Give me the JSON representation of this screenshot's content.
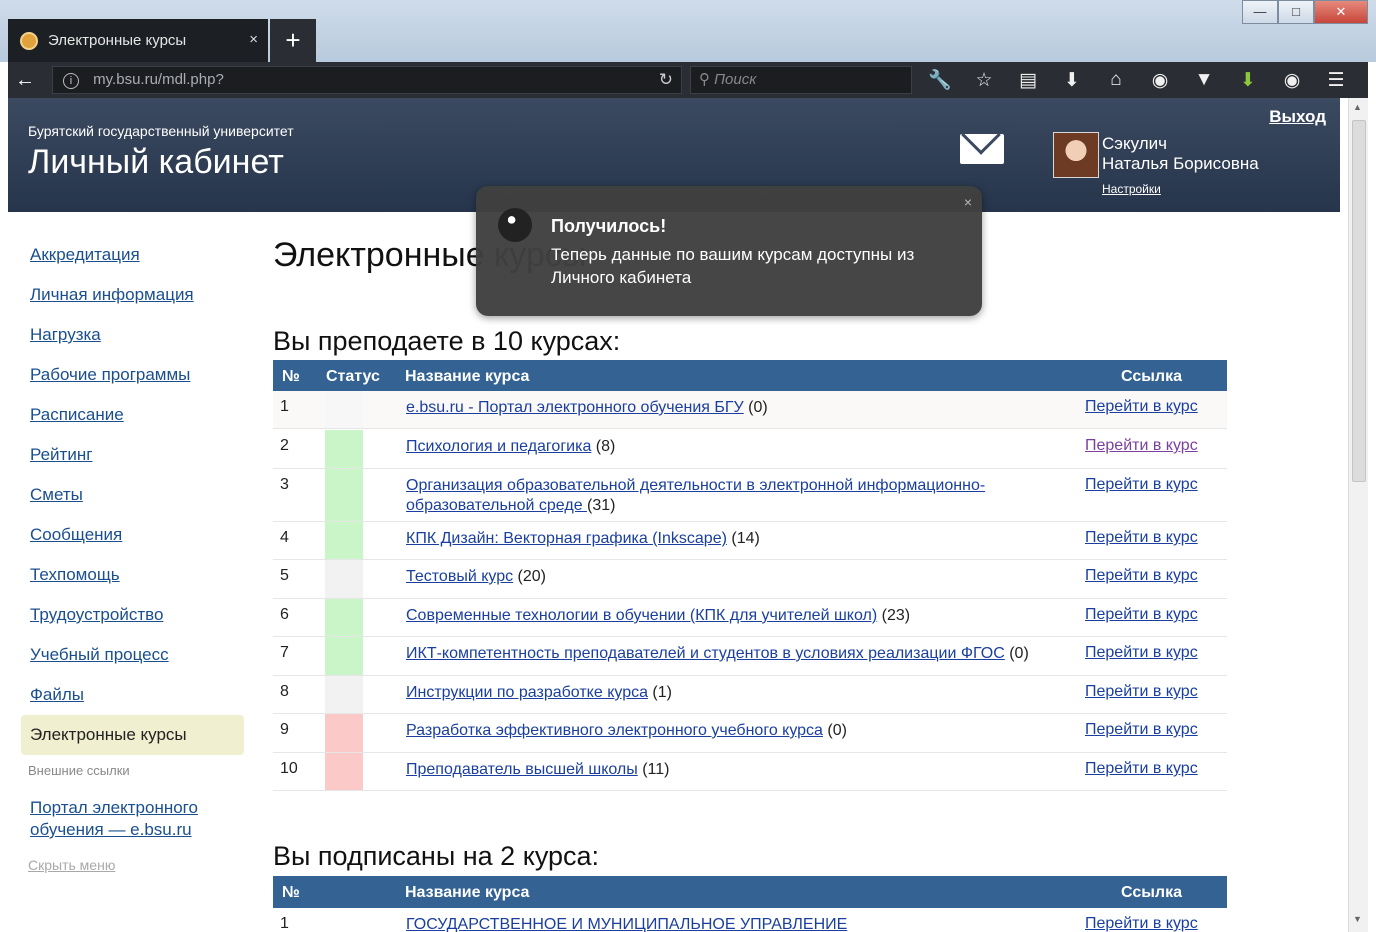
{
  "browser": {
    "tab_title": "Электронные курсы",
    "tab_close": "×",
    "new_tab": "+",
    "url": "my.bsu.ru/mdl.php?",
    "search_placeholder": "Поиск",
    "window_controls": {
      "minimize": "—",
      "maximize": "□",
      "close": "✕"
    },
    "toolbar_icons": [
      "wrench-icon",
      "star-icon",
      "reading-list-icon",
      "download-icon",
      "home-icon",
      "sync-icon",
      "pocket-icon",
      "downloader-icon",
      "color-icon",
      "menu-icon"
    ]
  },
  "header": {
    "university": "Бурятский государственный университет",
    "title": "Личный кабинет",
    "logout": "Выход",
    "user_surname": "Сэкулич",
    "user_name": "Наталья Борисовна",
    "settings": "Настройки"
  },
  "sidebar": {
    "items": [
      "Аккредитация",
      "Личная информация",
      "Нагрузка",
      "Рабочие программы",
      "Расписание",
      "Рейтинг",
      "Сметы",
      "Сообщения",
      "Техпомощь",
      "Трудоустройство",
      "Учебный процесс",
      "Файлы"
    ],
    "active": "Электронные курсы",
    "external_label": "Внешние ссылки",
    "external_link": "Портал электронного обучения — e.bsu.ru",
    "hide_menu": "Скрыть меню"
  },
  "main": {
    "title": "Электронные курсы",
    "teaching_heading": "Вы преподаете в 10 курсах:",
    "subscribed_heading": "Вы подписаны на 2 курса:",
    "columns": {
      "num": "№",
      "status": "Статус",
      "name": "Название курса",
      "link": "Ссылка"
    },
    "link_text": "Перейти в курс",
    "teaching": [
      {
        "num": "1",
        "status": "none",
        "name": "e.bsu.ru - Портал электронного обучения БГУ",
        "count": " (0)"
      },
      {
        "num": "2",
        "status": "green",
        "name": "Психология и педагогика",
        "count": " (8)"
      },
      {
        "num": "3",
        "status": "green",
        "name": "Организация образовательной деятельности в электронной информационно-образовательной среде ",
        "count": "(31)"
      },
      {
        "num": "4",
        "status": "green",
        "name": "КПК Дизайн: Векторная графика (Inkscape)",
        "count": " (14)"
      },
      {
        "num": "5",
        "status": "grey",
        "name": "Тестовый курс",
        "count": " (20)"
      },
      {
        "num": "6",
        "status": "green",
        "name": "Современные технологии в обучении (КПК для учителей школ)",
        "count": " (23)"
      },
      {
        "num": "7",
        "status": "green",
        "name": "ИКТ-компетентность преподавателей и студентов в условиях реализации ФГОС",
        "count": " (0)"
      },
      {
        "num": "8",
        "status": "grey",
        "name": "Инструкции по разработке курса",
        "count": " (1)"
      },
      {
        "num": "9",
        "status": "red",
        "name": "Разработка эффективного электронного учебного курса",
        "count": " (0)"
      },
      {
        "num": "10",
        "status": "red",
        "name": "Преподаватель высшей школы",
        "count": " (11)"
      }
    ],
    "subscribed": [
      {
        "num": "1",
        "name": "ГОСУДАРСТВЕННОЕ И МУНИЦИПАЛЬНОЕ УПРАВЛЕНИЕ"
      }
    ]
  },
  "status_colors": {
    "none": "#f7f7f7",
    "green": "#c9f5c9",
    "grey": "#f2f2f2",
    "red": "#fcc9c9"
  },
  "toast": {
    "title": "Получилось!",
    "message": "Теперь данные по вашим курсам доступны из Личного кабинета",
    "close": "×"
  }
}
